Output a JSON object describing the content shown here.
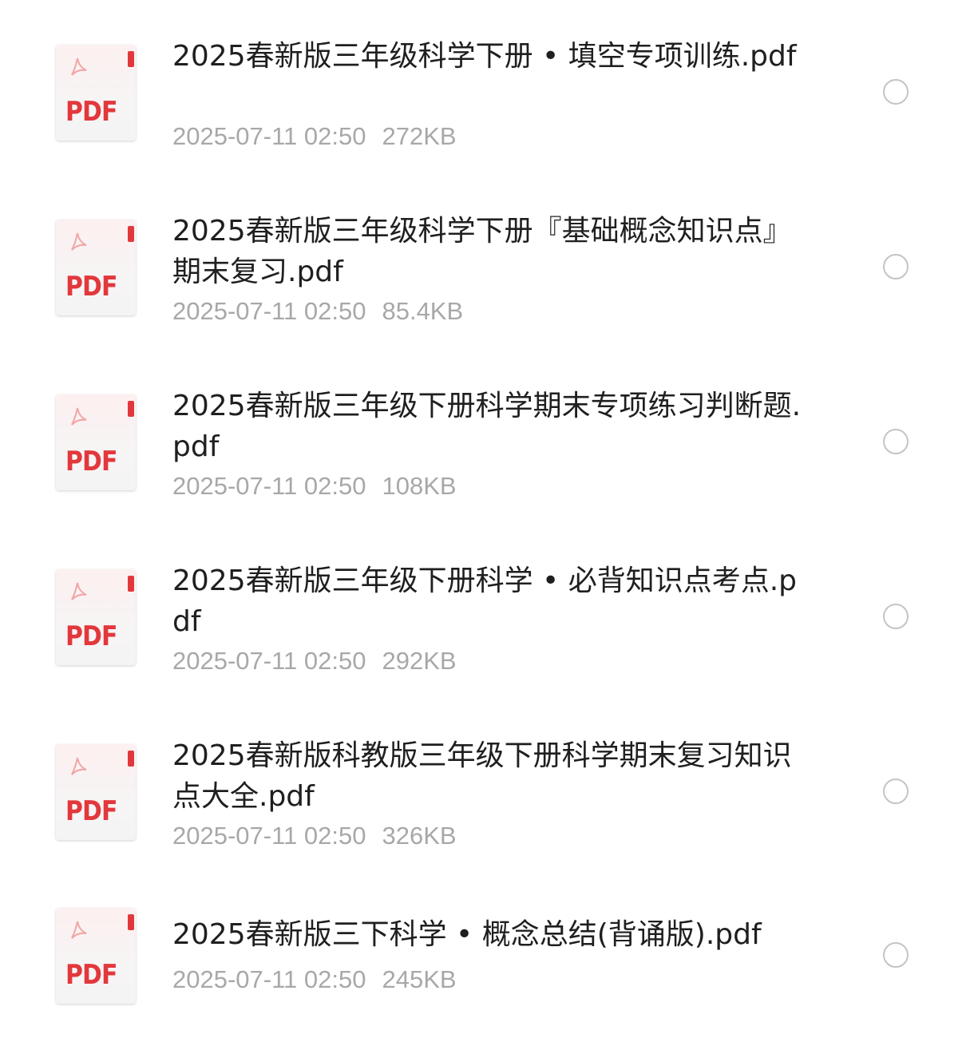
{
  "files": [
    {
      "name": "2025春新版三年级科学下册 • 填空专项训练.pdf",
      "date": "2025-07-11 02:50",
      "size": "272KB",
      "icon": "pdf-file-icon",
      "icon_label": "PDF",
      "selected": false
    },
    {
      "name": "2025春新版三年级科学下册『基础概念知识点』期末复习.pdf",
      "date": "2025-07-11 02:50",
      "size": "85.4KB",
      "icon": "pdf-file-icon",
      "icon_label": "PDF",
      "selected": false
    },
    {
      "name": "2025春新版三年级下册科学期末专项练习判断题.pdf",
      "date": "2025-07-11 02:50",
      "size": "108KB",
      "icon": "pdf-file-icon",
      "icon_label": "PDF",
      "selected": false
    },
    {
      "name": "2025春新版三年级下册科学 • 必背知识点考点.pdf",
      "date": "2025-07-11 02:50",
      "size": "292KB",
      "icon": "pdf-file-icon",
      "icon_label": "PDF",
      "selected": false
    },
    {
      "name": "2025春新版科教版三年级下册科学期末复习知识点大全.pdf",
      "date": "2025-07-11 02:50",
      "size": "326KB",
      "icon": "pdf-file-icon",
      "icon_label": "PDF",
      "selected": false
    },
    {
      "name": "2025春新版三下科学 • 概念总结(背诵版).pdf",
      "date": "2025-07-11 02:50",
      "size": "245KB",
      "icon": "pdf-file-icon",
      "icon_label": "PDF",
      "selected": false
    }
  ],
  "colors": {
    "pdf_red": "#e2383c",
    "title_text": "#1f1f1f",
    "meta_text": "#a8a8a8",
    "radio_border": "#c4c4c4"
  }
}
